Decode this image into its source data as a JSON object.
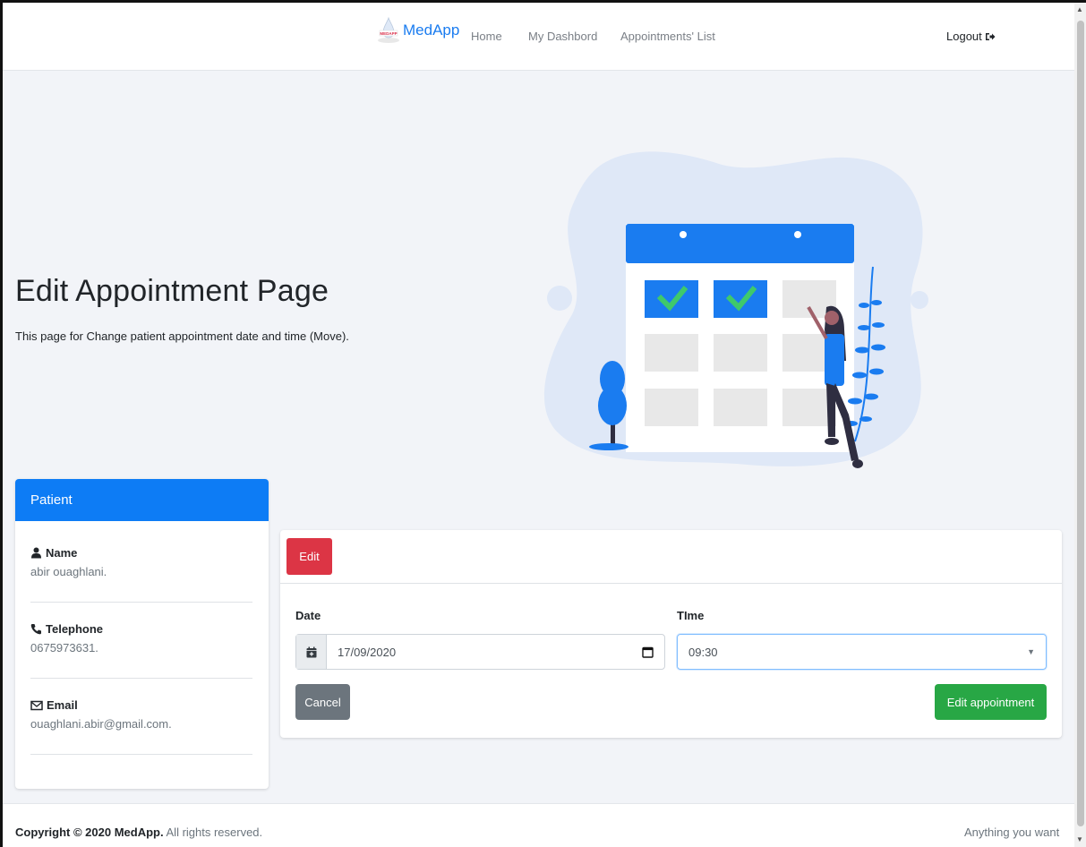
{
  "navbar": {
    "brand": "MedApp",
    "logo_text": "MEDAPP",
    "links": [
      {
        "label": "Home"
      },
      {
        "label": "My Dashbord"
      },
      {
        "label": "Appointments' List"
      }
    ],
    "logout": "Logout"
  },
  "hero": {
    "title": "Edit Appointment Page",
    "subtitle": "This page for Change patient appointment date and time (Move)."
  },
  "patient": {
    "header": "Patient",
    "name_label": "Name",
    "name_value": "abir ouaghlani.",
    "phone_label": "Telephone",
    "phone_value": "0675973631.",
    "email_label": "Email",
    "email_value": "ouaghlani.abir@gmail.com."
  },
  "edit_form": {
    "badge": "Edit",
    "date_label": "Date",
    "date_value": "17/09/2020",
    "time_label": "TIme",
    "time_value": "09:30",
    "cancel": "Cancel",
    "submit": "Edit appointment"
  },
  "footer": {
    "copyright_bold": "Copyright © 2020 MedApp.",
    "copyright_rest": " All rights reserved.",
    "right": "Anything you want"
  },
  "colors": {
    "primary": "#0d7cf5",
    "danger": "#dc3545",
    "success": "#28a745",
    "secondary": "#6c757d"
  }
}
